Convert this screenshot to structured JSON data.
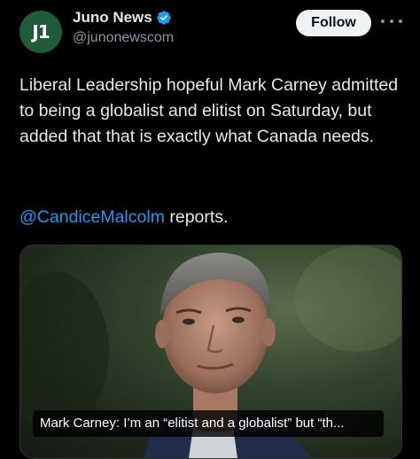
{
  "author": {
    "display_name": "Juno News",
    "handle": "@junonewscom",
    "avatar_text": "J1"
  },
  "actions": {
    "follow_label": "Follow"
  },
  "tweet": {
    "text": "Liberal Leadership hopeful Mark Carney admitted to being a globalist and elitist on Saturday, but added that that is exactly what Canada needs.",
    "mention": "@CandiceMalcolm",
    "mention_suffix": " reports."
  },
  "media": {
    "caption": "Mark Carney: I’m an “elitist and a globalist” but “th..."
  },
  "colors": {
    "background": "#000000",
    "text": "#e7e9ea",
    "link": "#1d9bf0",
    "verified": "#1d9bf0",
    "avatar": "#1f5a3b"
  },
  "icons": [
    "verified-badge-icon",
    "more-options-icon"
  ]
}
